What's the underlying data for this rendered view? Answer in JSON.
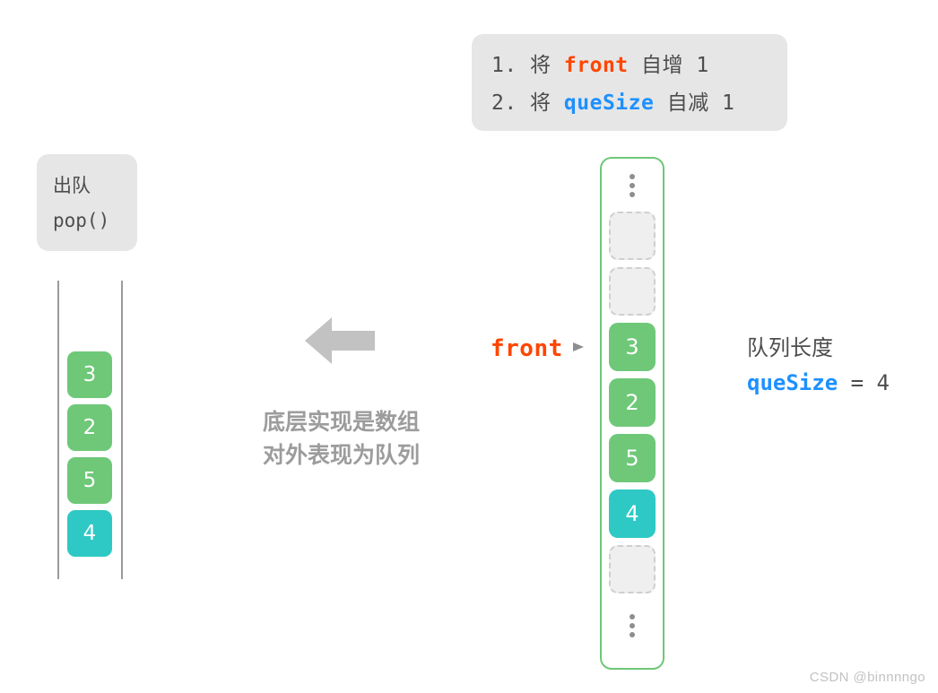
{
  "steps_box": {
    "lines": [
      {
        "index": "1. ",
        "verb_before": "将 ",
        "code": "front",
        "code_kind": "front",
        "verb_after": " 自增 ",
        "value": "1"
      },
      {
        "index": "2. ",
        "verb_before": "将 ",
        "code": "queSize",
        "code_kind": "quesize",
        "verb_after": " 自减 ",
        "value": "1"
      }
    ]
  },
  "pop_box": {
    "title": "出队",
    "method": "pop()"
  },
  "queue": {
    "cells": [
      {
        "value": "3",
        "color": "green"
      },
      {
        "value": "2",
        "color": "green"
      },
      {
        "value": "5",
        "color": "green"
      },
      {
        "value": "4",
        "color": "teal"
      }
    ]
  },
  "flow": {
    "arrow_icon": "arrow-left-icon",
    "caption_line1": "底层实现是数组",
    "caption_line2": "对外表现为队列"
  },
  "front_pointer": {
    "label": "front",
    "marker_icon": "triangle-right-icon"
  },
  "array": {
    "dots_top_icon": "vertical-ellipsis-icon",
    "dots_bottom_icon": "vertical-ellipsis-icon",
    "cells": [
      {
        "value": "",
        "state": "empty"
      },
      {
        "value": "",
        "state": "empty"
      },
      {
        "value": "3",
        "state": "green"
      },
      {
        "value": "2",
        "state": "green"
      },
      {
        "value": "5",
        "state": "green"
      },
      {
        "value": "4",
        "state": "teal"
      },
      {
        "value": "",
        "state": "empty"
      }
    ]
  },
  "size_note": {
    "label": "队列长度",
    "var_name": "queSize",
    "equals": " = ",
    "value": "4"
  },
  "watermark": {
    "text": "CSDN @binnnngo"
  },
  "colors": {
    "green": "#6ec878",
    "teal": "#2ec9c5",
    "front_orange": "#ff4500",
    "quesize_blue": "#1e90ff",
    "box_gray": "#e6e6e6",
    "text_gray": "#4d4d4d",
    "caption_gray": "#9c9c9c",
    "empty_fill": "#efefef",
    "empty_border": "#cfcfcf",
    "rail_gray": "#9a9a9a"
  }
}
